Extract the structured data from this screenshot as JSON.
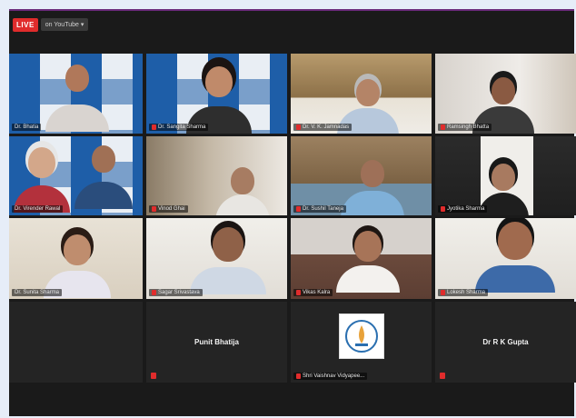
{
  "topbar": {
    "live_label": "LIVE",
    "platform_label": "on YouTube ▾"
  },
  "tiles": [
    {
      "name": "Dr. Bhatia"
    },
    {
      "name": "Dr. Sangita Sharma"
    },
    {
      "name": "Dr. V. K. Jamnadas"
    },
    {
      "name": "Ramsingh Bhatta"
    },
    {
      "name": "Dr. Virender Rawal"
    },
    {
      "name": "Vinod Ghai"
    },
    {
      "name": "Dr. Sushil Taneja"
    },
    {
      "name": "Jyotika Sharma"
    },
    {
      "name": "Dr. Sunita Sharma"
    },
    {
      "name": "Sagar Srivastava"
    },
    {
      "name": "Vikas Kalra"
    },
    {
      "name": "Lokesh Sharma"
    },
    {
      "name": "Punit Bhatija"
    },
    {
      "name": "Shri Vaishnav Vidyapee..."
    },
    {
      "name": "Dr R K Gupta"
    }
  ]
}
